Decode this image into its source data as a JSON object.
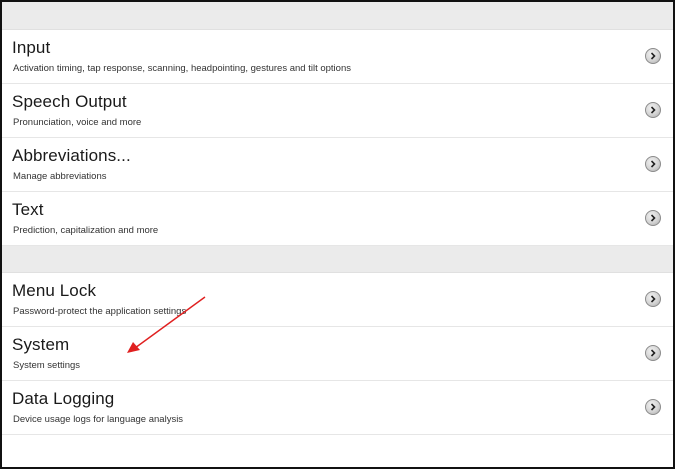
{
  "settings": {
    "group1": [
      {
        "title": "Input",
        "subtitle": "Activation timing, tap response, scanning, headpointing, gestures and tilt options",
        "icon": "chevron-right-icon"
      },
      {
        "title": "Speech Output",
        "subtitle": "Pronunciation, voice and more",
        "icon": "chevron-right-icon"
      },
      {
        "title": "Abbreviations...",
        "subtitle": "Manage abbreviations",
        "icon": "chevron-right-icon"
      },
      {
        "title": "Text",
        "subtitle": "Prediction, capitalization and more",
        "icon": "chevron-right-icon"
      }
    ],
    "group2": [
      {
        "title": "Menu Lock",
        "subtitle": "Password-protect the application settings",
        "icon": "chevron-right-icon"
      },
      {
        "title": "System",
        "subtitle": "System settings",
        "icon": "chevron-right-icon"
      },
      {
        "title": "Data Logging",
        "subtitle": "Device usage logs for language analysis",
        "icon": "chevron-right-icon"
      }
    ]
  },
  "annotation": {
    "arrow_color": "#e02020"
  }
}
